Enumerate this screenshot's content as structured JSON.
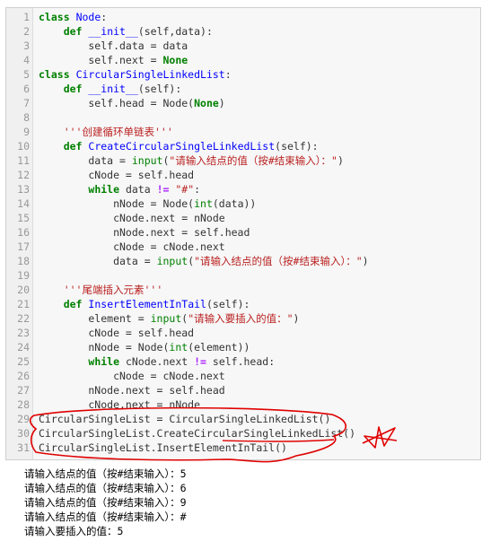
{
  "line_numbers": [
    "1",
    "2",
    "3",
    "4",
    "5",
    "6",
    "7",
    "8",
    "9",
    "10",
    "11",
    "12",
    "13",
    "14",
    "15",
    "16",
    "17",
    "18",
    "19",
    "20",
    "21",
    "22",
    "23",
    "24",
    "25",
    "26",
    "27",
    "28",
    "29",
    "30",
    "31"
  ],
  "code": {
    "l1": {
      "kw": "class",
      "name": "Node",
      "rest": ":"
    },
    "l2": {
      "ind": "    ",
      "kw": "def",
      "name": "__init__",
      "rest": "(self,data):"
    },
    "l3": {
      "text": "        self.data = data"
    },
    "l4": {
      "pre": "        self.next = ",
      "kw": "None"
    },
    "l5": {
      "kw": "class",
      "name": "CircularSingleLinkedList",
      "rest": ":"
    },
    "l6": {
      "ind": "    ",
      "kw": "def",
      "name": "__init__",
      "rest": "(self):"
    },
    "l7": {
      "pre": "        self.head = Node(",
      "kw": "None",
      "post": ")"
    },
    "l8": {
      "text": ""
    },
    "l9": {
      "ind": "    ",
      "str": "'''创建循环单链表'''"
    },
    "l10": {
      "ind": "    ",
      "kw": "def",
      "name": "CreateCircularSingleLinkedList",
      "rest": "(self):"
    },
    "l11": {
      "pre": "        data = ",
      "bi": "input",
      "p2": "(",
      "str": "\"请输入结点的值（按#结束输入）：\"",
      "post": ")"
    },
    "l12": {
      "text": "        cNode = self.head"
    },
    "l13": {
      "ind": "        ",
      "kw": "while",
      "mid": " data ",
      "op": "!=",
      "sp": " ",
      "str": "\"#\"",
      "post": ":"
    },
    "l14": {
      "pre": "            nNode = Node(",
      "bi": "int",
      "post": "(data))"
    },
    "l15": {
      "text": "            cNode.next = nNode"
    },
    "l16": {
      "text": "            nNode.next = self.head"
    },
    "l17": {
      "text": "            cNode = cNode.next"
    },
    "l18": {
      "pre": "            data = ",
      "bi": "input",
      "p2": "(",
      "str": "\"请输入结点的值（按#结束输入）：\"",
      "post": ")"
    },
    "l19": {
      "text": ""
    },
    "l20": {
      "ind": "    ",
      "str": "'''尾端插入元素'''"
    },
    "l21": {
      "ind": "    ",
      "kw": "def",
      "name": "InsertElementInTail",
      "rest": "(self):"
    },
    "l22": {
      "pre": "        element = ",
      "bi": "input",
      "p2": "(",
      "str": "\"请输入要插入的值：\"",
      "post": ")"
    },
    "l23": {
      "text": "        cNode = self.head"
    },
    "l24": {
      "pre": "        nNode = Node(",
      "bi": "int",
      "post": "(element))"
    },
    "l25": {
      "ind": "        ",
      "kw": "while",
      "mid": " cNode.next ",
      "op": "!=",
      "post": " self.head:"
    },
    "l26": {
      "text": "            cNode = cNode.next"
    },
    "l27": {
      "text": "        nNode.next = self.head"
    },
    "l28": {
      "text": "        cNode.next = nNode"
    },
    "l29": {
      "text": "CircularSingleList = CircularSingleLinkedList()"
    },
    "l30": {
      "text": "CircularSingleList.CreateCircularSingleLinkedList()"
    },
    "l31": {
      "text": "CircularSingleList.InsertElementInTail()"
    }
  },
  "output": [
    "请输入结点的值（按#结束输入）：5",
    "请输入结点的值（按#结束输入）：6",
    "请输入结点的值（按#结束输入）：9",
    "请输入结点的值（按#结束输入）：#",
    "请输入要插入的值：5"
  ],
  "colors": {
    "keyword": "#008000",
    "class_name": "#0000ff",
    "string": "#ba2121",
    "operator": "#aa22ff",
    "annotation": "#e00000"
  },
  "icons": [
    "hand-drawn-circle-annotation",
    "hand-drawn-star-annotation"
  ]
}
